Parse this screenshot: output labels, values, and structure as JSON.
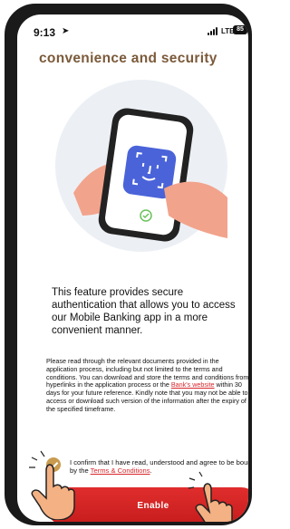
{
  "status_bar": {
    "time": "9:13",
    "network": "LTE",
    "battery": "85"
  },
  "header": {
    "title": "convenience and security"
  },
  "content": {
    "feature_text": "This feature provides secure authentication that allows you to access our Mobile Banking app in a more convenient manner.",
    "notice_part1": "Please read through the relevant documents provided in the application process, including but not limited to the terms and conditions. You can download and store the terms and conditions from hyperlinks in the application process or the ",
    "notice_link": "Bank's website",
    "notice_part2": " within 30 days for your future reference. Kindly note that you may not be able to access or download such version of the information after the expiry of the specified timeframe.",
    "confirm_part1": "I confirm that I have read, understood and agree to be bound by the ",
    "confirm_link": "Terms & Conditions",
    "confirm_part2": "."
  },
  "button": {
    "enable_label": "Enable"
  },
  "colors": {
    "title": "#7b5a3a",
    "accent_red": "#d7262b",
    "checkbox": "#c99b4f",
    "faceid_tile": "#4a63d9"
  },
  "icons": {
    "location_arrow": "location-icon",
    "face_id": "face-id-icon",
    "success_check": "checkmark-icon"
  }
}
